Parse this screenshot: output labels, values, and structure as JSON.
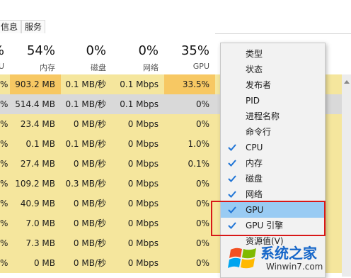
{
  "tabs": [
    "信息",
    "服务"
  ],
  "columns": [
    {
      "pct": "%",
      "label": "U"
    },
    {
      "pct": "54%",
      "label": "内存"
    },
    {
      "pct": "0%",
      "label": "磁盘"
    },
    {
      "pct": "0%",
      "label": "网络"
    },
    {
      "pct": "35%",
      "label": "GPU"
    }
  ],
  "rows": [
    {
      "c0": "%",
      "mem": "903.2 MB",
      "disk": "0.1 MB/秒",
      "net": "0.1 Mbps",
      "gpu": "33.5%",
      "selected": false
    },
    {
      "c0": "%",
      "mem": "514.4 MB",
      "disk": "0.1 MB/秒",
      "net": "0.1 Mbps",
      "gpu": "0%",
      "selected": true
    },
    {
      "c0": "%",
      "mem": "23.4 MB",
      "disk": "0 MB/秒",
      "net": "0 Mbps",
      "gpu": "0%",
      "selected": false
    },
    {
      "c0": "%",
      "mem": "0.1 MB",
      "disk": "0.1 MB/秒",
      "net": "0 Mbps",
      "gpu": "1.0%",
      "selected": false
    },
    {
      "c0": "%",
      "mem": "27.4 MB",
      "disk": "0 MB/秒",
      "net": "0 Mbps",
      "gpu": "0.1%",
      "selected": false
    },
    {
      "c0": "%",
      "mem": "109.2 MB",
      "disk": "0.3 MB/秒",
      "net": "0 Mbps",
      "gpu": "0%",
      "selected": false
    },
    {
      "c0": "%",
      "mem": "40.9 MB",
      "disk": "0 MB/秒",
      "net": "0 Mbps",
      "gpu": "0%",
      "selected": false
    },
    {
      "c0": "%",
      "mem": "7.0 MB",
      "disk": "0 MB/秒",
      "net": "0 Mbps",
      "gpu": "0%",
      "selected": false
    },
    {
      "c0": "%",
      "mem": "7.3 MB",
      "disk": "0 MB/秒",
      "net": "0 Mbps",
      "gpu": "0%",
      "selected": false
    },
    {
      "c0": "%",
      "mem": "0 MB",
      "disk": "0 MB/秒",
      "net": "0 Mbps",
      "gpu": "0%",
      "selected": false
    }
  ],
  "menu": [
    {
      "label": "类型",
      "checked": false,
      "highlighted": false
    },
    {
      "label": "状态",
      "checked": false,
      "highlighted": false
    },
    {
      "label": "发布者",
      "checked": false,
      "highlighted": false
    },
    {
      "label": "PID",
      "checked": false,
      "highlighted": false
    },
    {
      "label": "进程名称",
      "checked": false,
      "highlighted": false
    },
    {
      "label": "命令行",
      "checked": false,
      "highlighted": false
    },
    {
      "label": "CPU",
      "checked": true,
      "highlighted": false
    },
    {
      "label": "内存",
      "checked": true,
      "highlighted": false
    },
    {
      "label": "磁盘",
      "checked": true,
      "highlighted": false
    },
    {
      "label": "网络",
      "checked": true,
      "highlighted": false
    },
    {
      "label": "GPU",
      "checked": true,
      "highlighted": true
    },
    {
      "label": "GPU 引擎",
      "checked": true,
      "highlighted": false
    },
    {
      "label": "资源值(V)",
      "checked": false,
      "highlighted": false,
      "submenu": true
    }
  ],
  "watermark": {
    "title": "系统之家",
    "url": "Winwin7.com"
  },
  "colors": {
    "heat": "#f5e69d",
    "heat_strong": "#f7c863",
    "selected_row": "#d9d9d9",
    "menu_highlight": "#99cbf3",
    "check": "#1e74d6",
    "annotation": "#d81818"
  }
}
